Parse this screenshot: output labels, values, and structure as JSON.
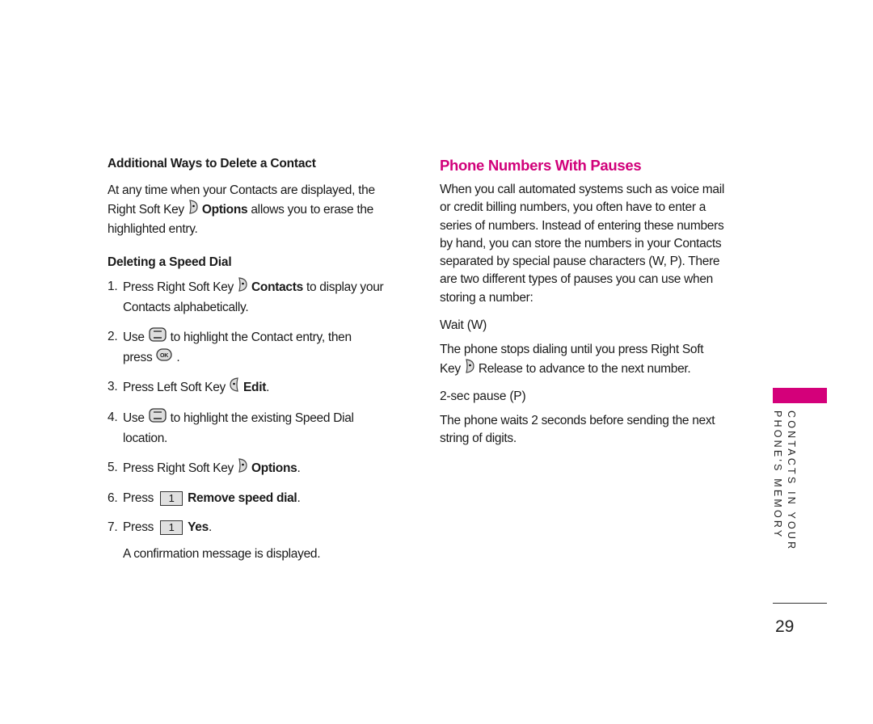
{
  "left": {
    "section1": {
      "title": "Additional Ways to Delete a Contact",
      "p1": "At any time when your Contacts are displayed, the",
      "p2_a": "Right Soft Key",
      "p2_b": "Options",
      "p2_c": " allows you to erase the",
      "p3": "highlighted entry."
    },
    "section2": {
      "title": "Deleting a Speed Dial",
      "steps": [
        {
          "num": "1.",
          "a": "Press Right Soft Key",
          "b": "Contacts",
          "c": " to display your",
          "line2": "Contacts alphabetically."
        },
        {
          "num": "2.",
          "a": "Use",
          "c": "to highlight the Contact entry, then",
          "line2_a": "press",
          "line2_b": "."
        },
        {
          "num": "3.",
          "a": "Press Left Soft Key",
          "b": "Edit",
          "c": "."
        },
        {
          "num": "4.",
          "a": "Use",
          "c": "to highlight the existing Speed Dial",
          "line2": "location."
        },
        {
          "num": "5.",
          "a": "Press Right Soft Key",
          "b": "Options",
          "c": "."
        },
        {
          "num": "6.",
          "a": "Press",
          "key": "1",
          "b": "Remove speed dial",
          "c": "."
        },
        {
          "num": "7.",
          "a": "Press",
          "key": "1",
          "b": "Yes",
          "c": "."
        }
      ],
      "note": "A confirmation message is displayed."
    }
  },
  "right": {
    "title": "Phone Numbers With Pauses",
    "intro": [
      "When you call automated systems such as voice mail",
      "or credit billing numbers, you often have to enter a",
      "series of numbers. Instead of entering these numbers",
      "by hand, you can store the numbers in your Contacts",
      "separated by special pause characters (W, P). There",
      "are two different types of pauses you can use when",
      "storing a number:"
    ],
    "wait_title": "Wait (W)",
    "wait_l1": "The phone stops dialing until you press Right Soft",
    "wait_l2_a": "Key",
    "wait_l2_b": "Release to advance to the next number.",
    "pause_title": "2-sec pause (P)",
    "pause_l1": "The phone waits 2 seconds before sending the next",
    "pause_l2": "string of digits."
  },
  "side": {
    "line1": "CONTACTS IN YOUR",
    "line2": "PHONE'S MEMORY",
    "accent": "#d4007a"
  },
  "page_number": "29"
}
